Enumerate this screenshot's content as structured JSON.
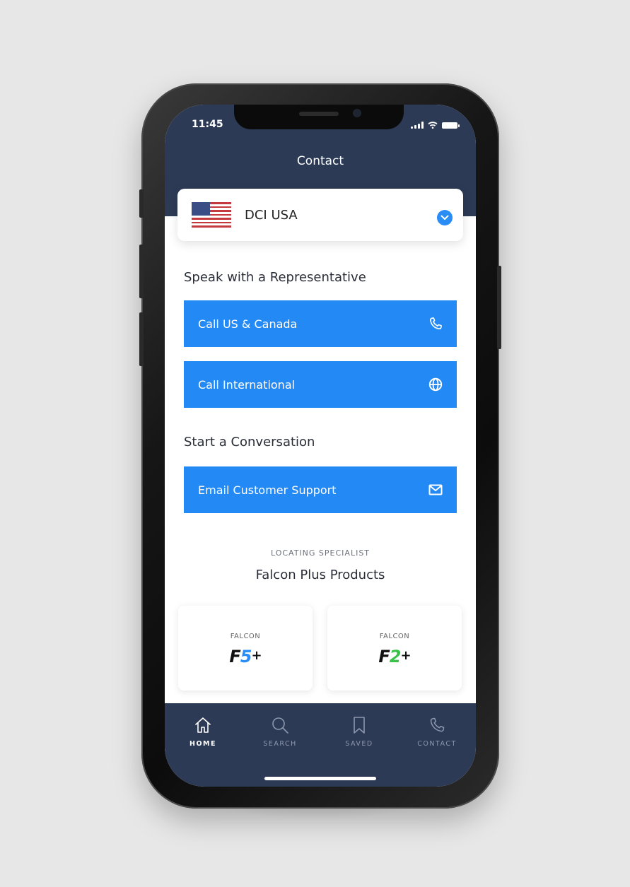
{
  "status_bar": {
    "time": "11:45"
  },
  "header": {
    "title": "Contact"
  },
  "country_selector": {
    "name": "DCI USA",
    "flag_icon": "us-flag-icon",
    "dropdown_icon": "chevron-down-icon"
  },
  "section_speak": {
    "heading": "Speak with a Representative"
  },
  "call_us_canada": {
    "label": "Call US & Canada",
    "icon": "phone-icon"
  },
  "call_international": {
    "label": "Call International",
    "icon": "globe-icon"
  },
  "section_conversation": {
    "heading": "Start a Conversation"
  },
  "email_support": {
    "label": "Email Customer Support",
    "icon": "mail-icon"
  },
  "specialist": {
    "subtitle": "LOCATING SPECIALIST",
    "title": "Falcon Plus Products"
  },
  "products": [
    {
      "brand": "FALCON",
      "model_prefix": "F",
      "model_number": "5",
      "model_suffix": "+",
      "accent": "#2a8cf5"
    },
    {
      "brand": "FALCON",
      "model_prefix": "F",
      "model_number": "2",
      "model_suffix": "+",
      "accent": "#39c24a"
    }
  ],
  "tabbar": {
    "items": [
      {
        "label": "HOME",
        "icon": "home-icon",
        "active": true
      },
      {
        "label": "SEARCH",
        "icon": "search-icon",
        "active": false
      },
      {
        "label": "SAVED",
        "icon": "bookmark-icon",
        "active": false
      },
      {
        "label": "CONTACT",
        "icon": "phone-icon",
        "active": false
      }
    ]
  },
  "colors": {
    "header": "#2d3a55",
    "primary_button": "#2389f5",
    "background": "#e7e7e7",
    "tab_active": "#ffffff",
    "tab_inactive": "#8d97ad"
  }
}
